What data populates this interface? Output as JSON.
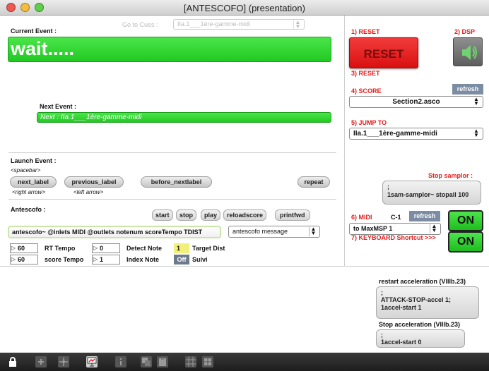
{
  "window": {
    "title": "[ANTESCOFO] (presentation)"
  },
  "left": {
    "current_event_label": "Current Event :",
    "goto_cues_label": "Go to Cues :",
    "goto_cues_value": "IIa.1___1ère-gamme-midi",
    "current_event_value": "wait.....",
    "next_event_label": "Next Event :",
    "next_event_value": "Next : IIa.1___1ère-gamme-midi",
    "launch_event_label": "Launch Event :",
    "spacebar_hint": "<spacebar>",
    "next_label_btn": "next_label",
    "previous_label_btn": "previous_label",
    "before_nextlabel_btn": "before_nextlabel",
    "repeat_btn": "repeat",
    "right_arrow_hint": "<right arrow>",
    "left_arrow_hint": "<left arrow>",
    "antescofo_label": "Antescofo :",
    "start_btn": "start",
    "stop_btn": "stop",
    "play_btn": "play",
    "reloadscore_btn": "reloadscore",
    "printfwd_btn": "printfwd",
    "object_box": "antescofo~ @inlets MIDI @outlets notenum scoreTempo TDIST",
    "message_menu": "antescofo message",
    "rt_tempo_value": "60",
    "rt_tempo_label": "RT Tempo",
    "score_tempo_value": "60",
    "score_tempo_label": "score Tempo",
    "detect_note_value": "0",
    "detect_note_label": "Detect Note",
    "index_note_value": "1",
    "index_note_label": "Index Note",
    "target_dist_value": "1",
    "target_dist_label": "Target Dist",
    "suivi_toggle": "Off",
    "suivi_label": "Suivi"
  },
  "right": {
    "reset_label": "1) RESET",
    "dsp_label": "2) DSP",
    "reset_btn": "RESET",
    "reset_label3": "3) RESET",
    "score_label": "4) SCORE",
    "refresh_btn": "refresh",
    "score_file": "Section2.asco",
    "jump_to_label": "5) JUMP TO",
    "jump_to_value": "IIa.1___1ère-gamme-midi",
    "stop_samplor_label": "Stop samplor :",
    "stop_samplor_msg1": ";",
    "stop_samplor_msg2": "1sam-samplor~ stopall 100",
    "midi_label": "6) MIDI",
    "midi_channel": "C-1",
    "midi_refresh_btn": "refresh",
    "midi_output": "to MaxMSP 1",
    "midi_on_btn": "ON",
    "keyboard_label": "7) KEYBOARD Shortcut >>>",
    "keyboard_on_btn": "ON"
  },
  "bottom": {
    "restart_accel_label": "restart acceleration (VIIIb.23)",
    "restart_msg1": ";",
    "restart_msg2": "ATTACK-STOP-accel 1;",
    "restart_msg3": "1accel-start 1",
    "stop_accel_label": "Stop acceleration (VIIIb.23)",
    "stop_msg1": ";",
    "stop_msg2": "1accel-start 0"
  },
  "colors": {
    "green": "#2bd62b",
    "reset_red": "#ee1c1c",
    "label_red": "#e41c1c"
  },
  "icons": [
    "lock-icon",
    "plus-icon",
    "move-icon",
    "presentation-icon",
    "info-icon",
    "copy-icon",
    "paste-icon",
    "grid-icon",
    "snap-icon",
    "speaker-icon"
  ]
}
